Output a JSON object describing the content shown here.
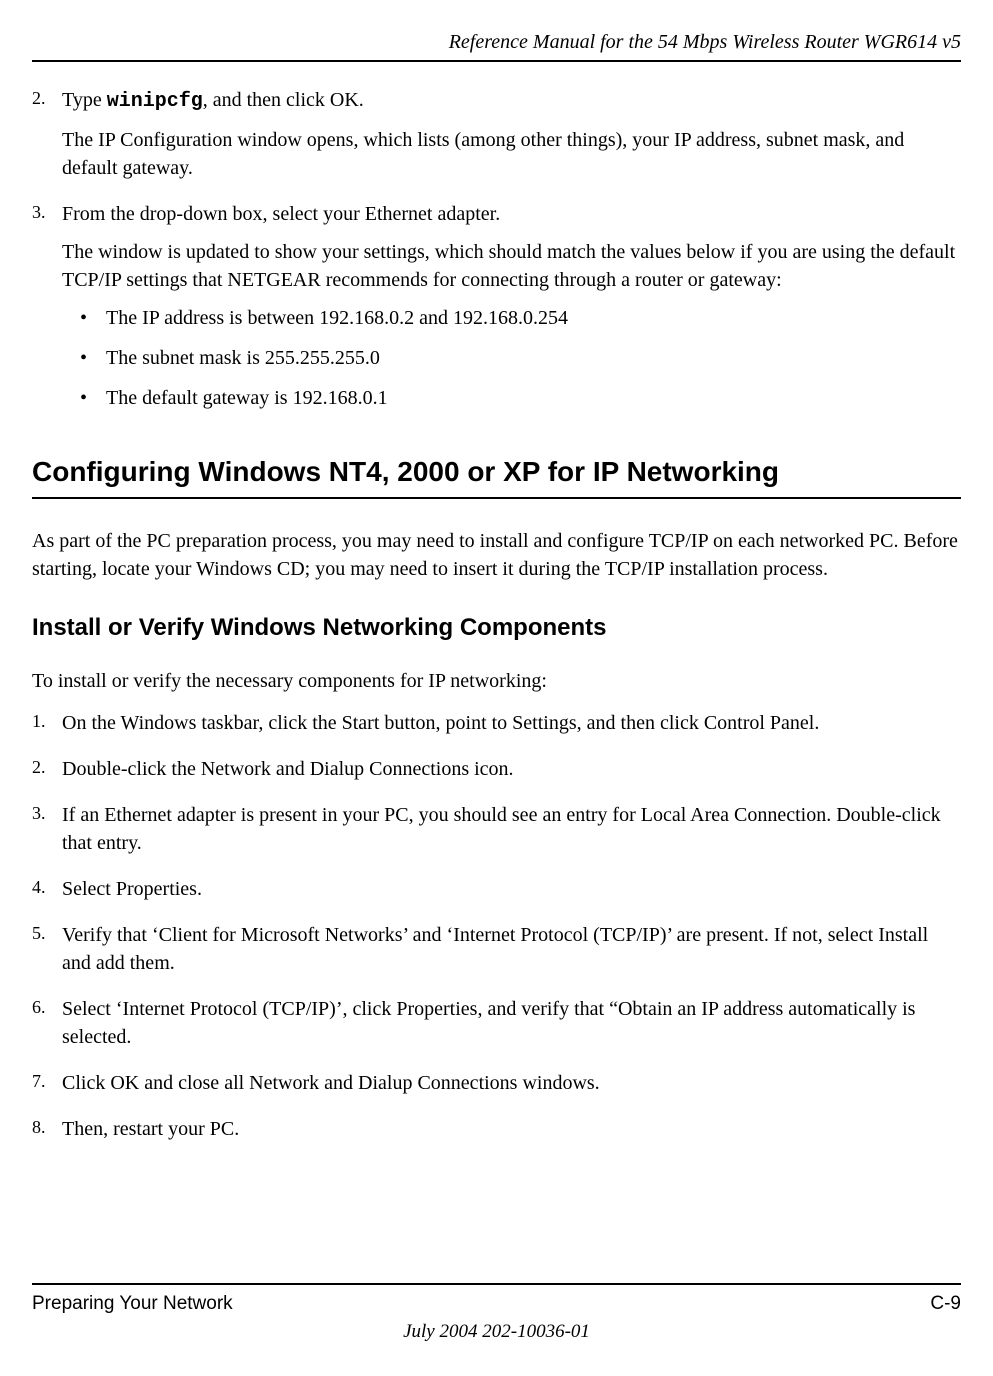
{
  "header": {
    "title": "Reference Manual for the 54 Mbps Wireless Router WGR614 v5"
  },
  "section1": {
    "step2": {
      "num": "2.",
      "text_before": "Type ",
      "code": "winipcfg",
      "text_after": ", and then click OK.",
      "para2": "The IP Configuration window opens, which lists (among other things), your IP address, subnet mask, and default gateway."
    },
    "step3": {
      "num": "3.",
      "text": "From the drop-down box, select your Ethernet adapter.",
      "para2": "The window is updated to show your settings, which should match the values below if you are using the default TCP/IP settings that NETGEAR recommends for connecting through a router or gateway:",
      "bullets": [
        "The IP address is between 192.168.0.2 and 192.168.0.254",
        "The subnet mask is 255.255.255.0",
        "The default gateway is 192.168.0.1"
      ]
    }
  },
  "heading1": "Configuring Windows NT4, 2000 or XP for IP Networking",
  "para1": "As part of the PC preparation process, you may need to install and configure TCP/IP on each networked PC. Before starting, locate your Windows CD; you may need to insert it during the TCP/IP installation process.",
  "heading2": "Install or Verify Windows Networking Components",
  "intro2": "To install or verify the necessary components for IP networking:",
  "steps2": [
    {
      "num": "1.",
      "text": "On the Windows taskbar, click the Start button, point to Settings, and then click Control Panel."
    },
    {
      "num": "2.",
      "text": "Double-click the Network and Dialup Connections icon."
    },
    {
      "num": "3.",
      "text": "If an Ethernet adapter is present in your PC, you should see an entry for Local Area Connection. Double-click that entry."
    },
    {
      "num": "4.",
      "text": "Select Properties."
    },
    {
      "num": "5.",
      "text": "Verify that ‘Client for Microsoft Networks’ and ‘Internet Protocol (TCP/IP)’ are present. If not, select Install and add them."
    },
    {
      "num": "6.",
      "text": "Select ‘Internet Protocol (TCP/IP)’, click Properties, and verify that “Obtain an IP address automatically is selected."
    },
    {
      "num": "7.",
      "text": "Click OK and close all Network and Dialup Connections windows."
    },
    {
      "num": "8.",
      "text": "Then, restart your PC."
    }
  ],
  "footer": {
    "left": "Preparing Your Network",
    "right": "C-9",
    "date": "July 2004 202-10036-01"
  }
}
